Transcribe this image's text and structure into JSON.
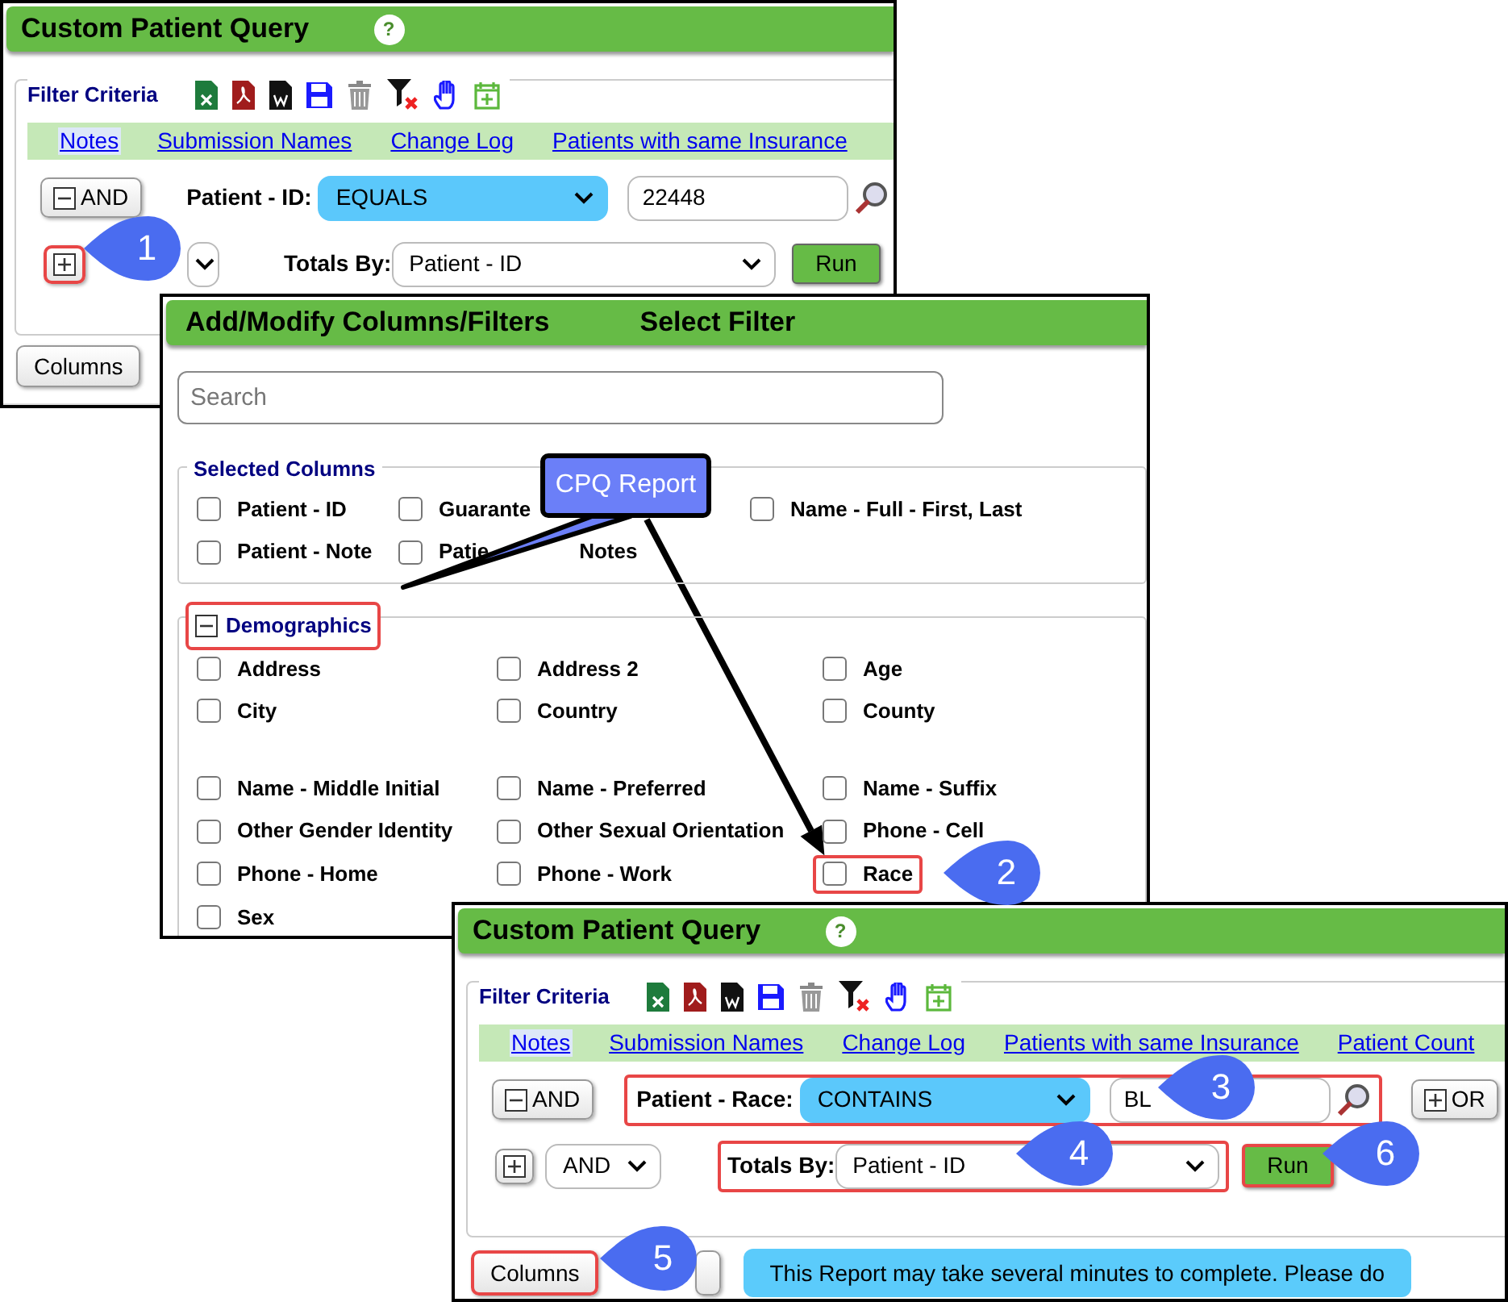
{
  "top_query": {
    "title": "Custom Patient Query",
    "help": "?",
    "filter_label": "Filter Criteria",
    "links": [
      {
        "label": "Notes",
        "selected": true
      },
      {
        "label": "Submission Names",
        "selected": false
      },
      {
        "label": "Change Log",
        "selected": false
      },
      {
        "label": "Patients with same Insurance",
        "selected": false
      }
    ],
    "condition": {
      "connector": "AND",
      "field": "Patient - ID:",
      "operator": "EQUALS",
      "value": "22448",
      "highlighted": false
    },
    "add_button": {
      "highlighted": true
    },
    "totals": {
      "label": "Totals By:",
      "value": "Patient - ID",
      "highlighted": false
    },
    "run": {
      "label": "Run",
      "highlighted": false
    },
    "columns": {
      "label": "Columns",
      "highlighted": false
    }
  },
  "column_picker": {
    "title": "Add/Modify Columns/Filters",
    "subtitle": "Select Filter",
    "search": {
      "placeholder": "Search"
    },
    "selected_columns": {
      "legend": "Selected Columns",
      "rows": [
        [
          {
            "label": "Patient - ID",
            "checked": false
          },
          {
            "label": "Guarante",
            "checked": false
          },
          {
            "label": "Name - Full - First, Last",
            "checked": false
          }
        ],
        [
          {
            "label": "Patient - Note",
            "checked": false
          },
          {
            "label": "Patie",
            "checked": false,
            "after": "Notes"
          }
        ]
      ]
    },
    "demographics": {
      "label": "Demographics",
      "expanded": true,
      "highlighted": true,
      "groups": [
        [
          {
            "label": "Address",
            "checked": false,
            "highlighted": false
          },
          {
            "label": "Address 2",
            "checked": false,
            "highlighted": false
          },
          {
            "label": "Age",
            "checked": false,
            "highlighted": false
          },
          {
            "label": "City",
            "checked": false,
            "highlighted": false
          },
          {
            "label": "Country",
            "checked": false,
            "highlighted": false
          },
          {
            "label": "County",
            "checked": false,
            "highlighted": false
          }
        ],
        [
          {
            "label": "Name - Middle Initial",
            "checked": false,
            "highlighted": false
          },
          {
            "label": "Name - Preferred",
            "checked": false,
            "highlighted": false
          },
          {
            "label": "Name - Suffix",
            "checked": false,
            "highlighted": false
          },
          {
            "label": "Other Gender Identity",
            "checked": false,
            "highlighted": false
          },
          {
            "label": "Other Sexual Orientation",
            "checked": false,
            "highlighted": false
          },
          {
            "label": "Phone - Cell",
            "checked": false,
            "highlighted": false
          },
          {
            "label": "Phone - Home",
            "checked": false,
            "highlighted": false
          },
          {
            "label": "Phone - Work",
            "checked": false,
            "highlighted": false
          },
          {
            "label": "Race",
            "checked": false,
            "highlighted": true
          },
          {
            "label": "Sex",
            "checked": false,
            "highlighted": false
          }
        ]
      ]
    },
    "callout": {
      "text": "CPQ Report"
    }
  },
  "bottom_query": {
    "title": "Custom Patient Query",
    "help": "?",
    "filter_label": "Filter Criteria",
    "links": [
      {
        "label": "Notes",
        "selected": true
      },
      {
        "label": "Submission Names",
        "selected": false
      },
      {
        "label": "Change Log",
        "selected": false
      },
      {
        "label": "Patients with same Insurance",
        "selected": false
      },
      {
        "label": "Patient Count",
        "selected": false
      }
    ],
    "condition": {
      "connector": "AND",
      "field": "Patient - Race:",
      "operator": "CONTAINS",
      "value": "BL",
      "highlighted": true
    },
    "or_button": "OR",
    "add_button": {
      "highlighted": false
    },
    "join": "AND",
    "totals": {
      "label": "Totals By:",
      "value": "Patient - ID",
      "highlighted": true
    },
    "run": {
      "label": "Run",
      "highlighted": true
    },
    "columns": {
      "label": "Columns",
      "highlighted": true
    },
    "message": "This Report may take several minutes to complete. Please do"
  },
  "step_markers": [
    "1",
    "2",
    "3",
    "4",
    "5",
    "6"
  ]
}
